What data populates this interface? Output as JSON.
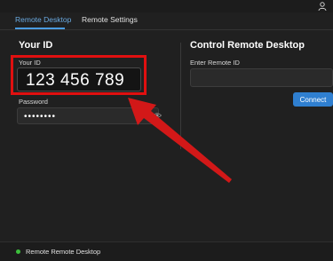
{
  "tabs": [
    {
      "label": "Remote Desktop",
      "active": true
    },
    {
      "label": "Remote Settings",
      "active": false
    }
  ],
  "left_panel": {
    "heading": "Your ID",
    "id_label": "Your ID",
    "id_value": "123 456 789",
    "password_label": "Password",
    "password_value": "••••••••"
  },
  "right_panel": {
    "heading": "Control Remote Desktop",
    "remote_id_label": "Enter Remote ID",
    "remote_id_value": "",
    "connect_label": "Connect"
  },
  "status": {
    "text": "Remote Remote Desktop",
    "indicator_color": "#3cc03c"
  },
  "colors": {
    "accent": "#2f7fd0",
    "highlight": "#e01010",
    "background": "#202020"
  },
  "icons": [
    "user-icon",
    "eye-icon",
    "red-arrow"
  ]
}
